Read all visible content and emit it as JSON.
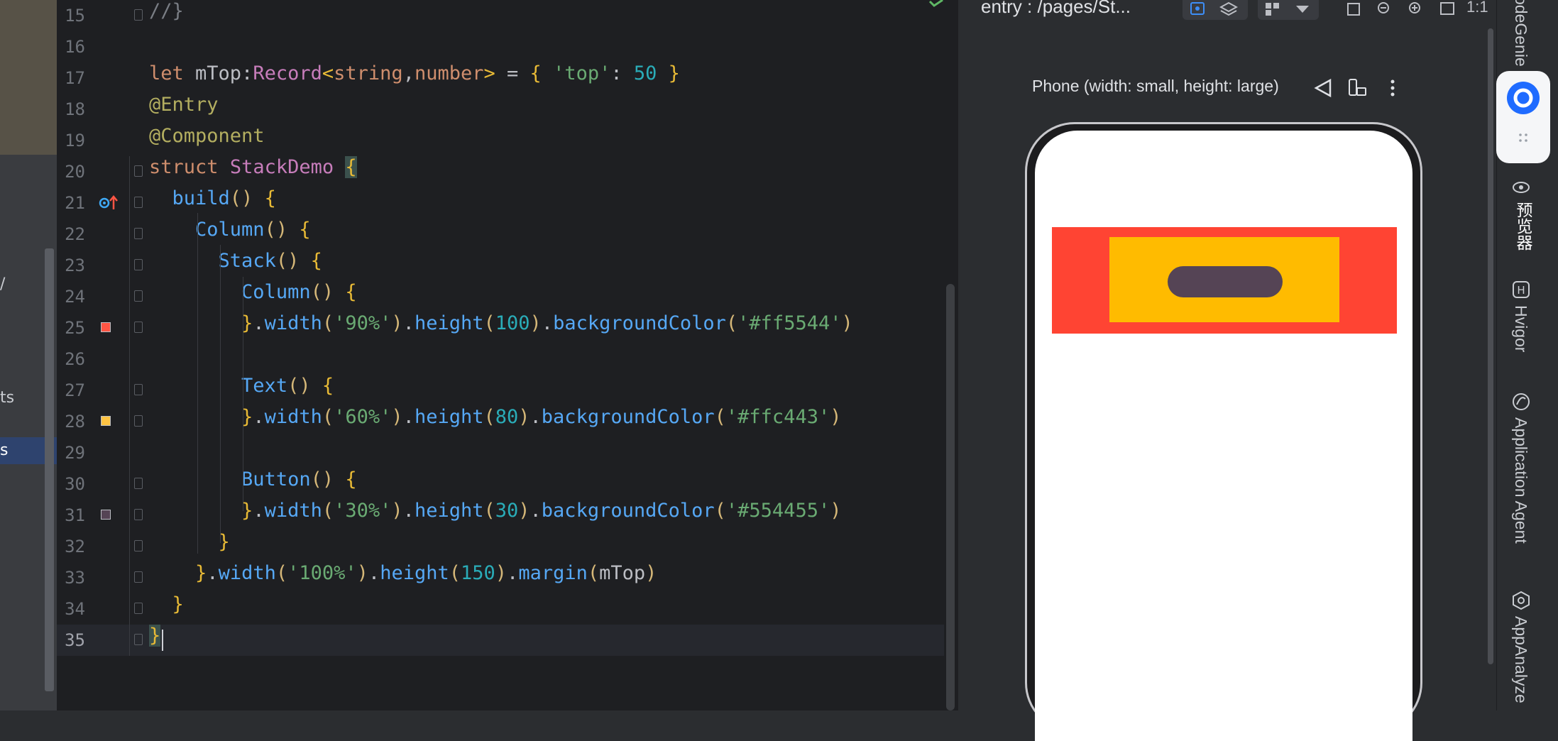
{
  "left_panel": {
    "fragments": [
      "/",
      "ts",
      "s"
    ]
  },
  "editor": {
    "lines": [
      {
        "n": "15",
        "html": "<span class=\"cm\">//}</span>"
      },
      {
        "n": "16",
        "html": ""
      },
      {
        "n": "17",
        "html": "<span class=\"kw\">let</span> mTop:<span class=\"ty\">Record</span><span class=\"br\">&lt;</span><span class=\"kw\">string</span>,<span class=\"kw\">number</span><span class=\"br\">&gt;</span> = <span class=\"br\">{</span> <span class=\"st\">'top'</span>: <span class=\"nu\">50</span> <span class=\"br\">}</span>"
      },
      {
        "n": "18",
        "html": "<span class=\"dc\">@Entry</span>"
      },
      {
        "n": "19",
        "html": "<span class=\"dc\">@Component</span>"
      },
      {
        "n": "20",
        "html": "<span class=\"kw\">struct</span> <span class=\"ty\">StackDemo</span> <span class=\"br hl\">{</span>"
      },
      {
        "n": "21",
        "html": "  <span class=\"fn\">build</span><span class=\"p2\">()</span> <span class=\"br\">{</span>"
      },
      {
        "n": "22",
        "html": "    <span class=\"fn\">Column</span><span class=\"p2\">()</span> <span class=\"br\">{</span>"
      },
      {
        "n": "23",
        "html": "      <span class=\"fn\">Stack</span><span class=\"p2\">()</span> <span class=\"br\">{</span>"
      },
      {
        "n": "24",
        "html": "        <span class=\"fn\">Column</span><span class=\"p2\">()</span> <span class=\"br\">{</span>"
      },
      {
        "n": "25",
        "html": "        <span class=\"br\">}</span>.<span class=\"fn\">width</span><span class=\"p2\">(</span><span class=\"st\">'90%'</span><span class=\"p2\">)</span>.<span class=\"fn\">height</span><span class=\"p2\">(</span><span class=\"nu\">100</span><span class=\"p2\">)</span>.<span class=\"fn\">backgroundColor</span><span class=\"p2\">(</span><span class=\"st\">'#ff5544'</span><span class=\"p2\">)</span>"
      },
      {
        "n": "26",
        "html": ""
      },
      {
        "n": "27",
        "html": "        <span class=\"fn\">Text</span><span class=\"p2\">()</span> <span class=\"br\">{</span>"
      },
      {
        "n": "28",
        "html": "        <span class=\"br\">}</span>.<span class=\"fn\">width</span><span class=\"p2\">(</span><span class=\"st\">'60%'</span><span class=\"p2\">)</span>.<span class=\"fn\">height</span><span class=\"p2\">(</span><span class=\"nu\">80</span><span class=\"p2\">)</span>.<span class=\"fn\">backgroundColor</span><span class=\"p2\">(</span><span class=\"st\">'#ffc443'</span><span class=\"p2\">)</span>"
      },
      {
        "n": "29",
        "html": ""
      },
      {
        "n": "30",
        "html": "        <span class=\"fn\">Button</span><span class=\"p2\">()</span> <span class=\"br\">{</span>"
      },
      {
        "n": "31",
        "html": "        <span class=\"br\">}</span>.<span class=\"fn\">width</span><span class=\"p2\">(</span><span class=\"st\">'30%'</span><span class=\"p2\">)</span>.<span class=\"fn\">height</span><span class=\"p2\">(</span><span class=\"nu\">30</span><span class=\"p2\">)</span>.<span class=\"fn\">backgroundColor</span><span class=\"p2\">(</span><span class=\"st\">'#554455'</span><span class=\"p2\">)</span>"
      },
      {
        "n": "32",
        "html": "      <span class=\"br\">}</span>"
      },
      {
        "n": "33",
        "html": "    <span class=\"br\">}</span>.<span class=\"fn\">width</span><span class=\"p2\">(</span><span class=\"st\">'100%'</span><span class=\"p2\">)</span>.<span class=\"fn\">height</span><span class=\"p2\">(</span><span class=\"nu\">150</span><span class=\"p2\">)</span>.<span class=\"fn\">margin</span><span class=\"p2\">(</span>mTop<span class=\"p2\">)</span>"
      },
      {
        "n": "34",
        "html": "  <span class=\"br\">}</span>"
      },
      {
        "n": "35",
        "html": "<span class=\"br hl\">}</span>"
      }
    ],
    "color_markers": {
      "25": "#ff5544",
      "28": "#ffc443",
      "31": "#554455"
    },
    "current_line": "35"
  },
  "preview": {
    "title": "entry : /pages/St...",
    "device_label": "Phone (width: small, height: large)",
    "zoom_label": "1:1",
    "colors": {
      "red": "#ff4433",
      "yellow": "#ffbb00",
      "button": "#554455"
    }
  },
  "right_strip": {
    "tabs": [
      "odeGenie",
      "预览器",
      "Hvigor",
      "Application Agent",
      "AppAnalyze"
    ]
  }
}
